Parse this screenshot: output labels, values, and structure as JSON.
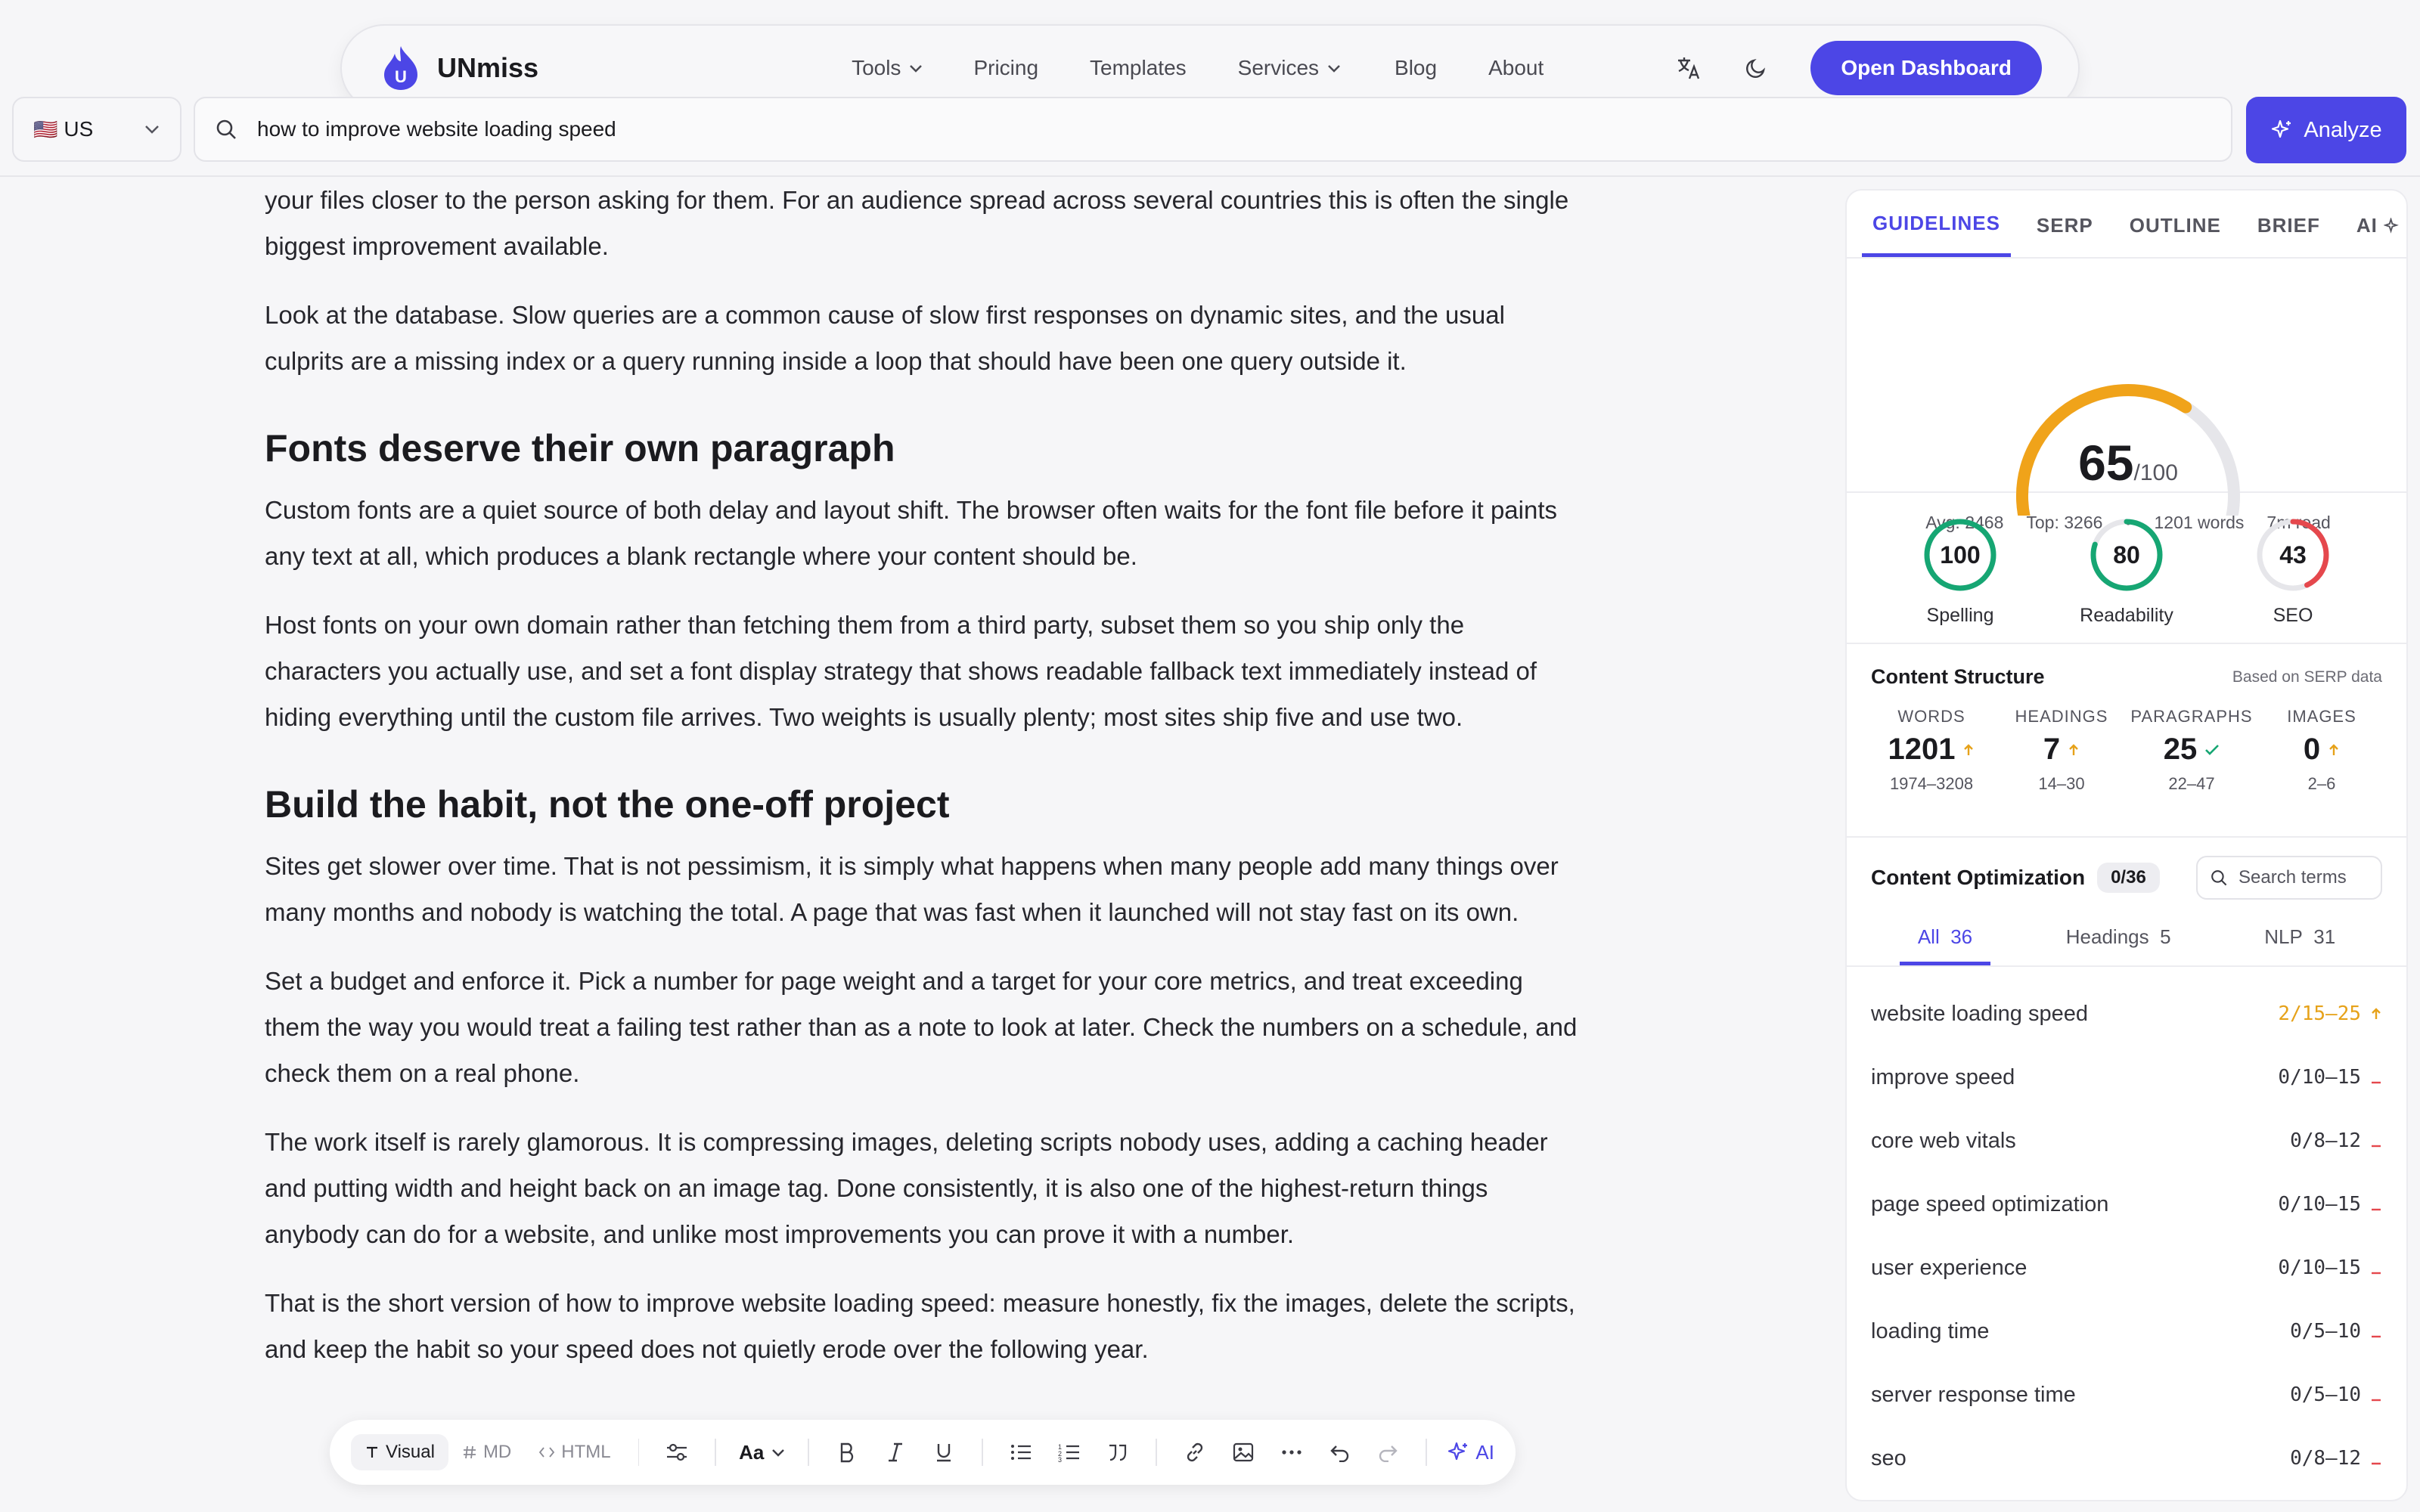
{
  "nav": {
    "brand": "UNmiss",
    "brand_initial": "U",
    "links": [
      "Tools",
      "Pricing",
      "Templates",
      "Services",
      "Blog",
      "About"
    ],
    "open_dashboard": "Open Dashboard",
    "translate_icon": "translate-icon",
    "theme_icon": "moon-icon"
  },
  "search": {
    "country": "US",
    "country_flag": "🇺🇸",
    "query": "how to improve website loading speed",
    "analyze": "Analyze"
  },
  "editor": {
    "p0": "your files closer to the person asking for them. For an audience spread across several countries this is often the single biggest improvement available.",
    "p1": "Look at the database. Slow queries are a common cause of slow first responses on dynamic sites, and the usual culprits are a missing index or a query running inside a loop that should have been one query outside it.",
    "h1": "Fonts deserve their own paragraph",
    "p2": "Custom fonts are a quiet source of both delay and layout shift. The browser often waits for the font file before it paints any text at all, which produces a blank rectangle where your content should be.",
    "p3": "Host fonts on your own domain rather than fetching them from a third party, subset them so you ship only the characters you actually use, and set a font display strategy that shows readable fallback text immediately instead of hiding everything until the custom file arrives. Two weights is usually plenty; most sites ship five and use two.",
    "h2": "Build the habit, not the one-off project",
    "p4": "Sites get slower over time. That is not pessimism, it is simply what happens when many people add many things over many months and nobody is watching the total. A page that was fast when it launched will not stay fast on its own.",
    "p5": "Set a budget and enforce it. Pick a number for page weight and a target for your core metrics, and treat exceeding them the way you would treat a failing test rather than as a note to look at later. Check the numbers on a schedule, and check them on a real phone.",
    "p6": "The work itself is rarely glamorous. It is compressing images, deleting scripts nobody uses, adding a caching header and putting width and height back on an image tag. Done consistently, it is also one of the highest-return things anybody can do for a website, and unlike most improvements you can prove it with a number.",
    "p7": "That is the short version of how to improve website loading speed: measure honestly, fix the images, delete the scripts, and keep the habit so your speed does not quietly erode over the following year."
  },
  "toolbar": {
    "modes": [
      "Visual",
      "MD",
      "HTML"
    ],
    "font_label": "Aa",
    "ai_label": "AI"
  },
  "panel": {
    "tabs": [
      "GUIDELINES",
      "SERP",
      "OUTLINE",
      "BRIEF",
      "AI"
    ],
    "score": {
      "value": "65",
      "denominator": "/100",
      "fraction": 0.65,
      "avg": "Avg: 2468",
      "top": "Top: 3266",
      "bullet": "•",
      "words": "1201 words",
      "read": "7m read"
    },
    "rings": [
      {
        "value": "100",
        "label": "Spelling",
        "fraction": 1.0,
        "color": "#16a673"
      },
      {
        "value": "80",
        "label": "Readability",
        "fraction": 0.8,
        "color": "#16a673"
      },
      {
        "value": "43",
        "label": "SEO",
        "fraction": 0.43,
        "color": "#e5484d"
      }
    ],
    "structure": {
      "title": "Content Structure",
      "note": "Based on SERP data",
      "cols": [
        {
          "label": "WORDS",
          "value": "1201",
          "range": "1974–3208",
          "status": "up"
        },
        {
          "label": "HEADINGS",
          "value": "7",
          "range": "14–30",
          "status": "up"
        },
        {
          "label": "PARAGRAPHS",
          "value": "25",
          "range": "22–47",
          "status": "ok"
        },
        {
          "label": "IMAGES",
          "value": "0",
          "range": "2–6",
          "status": "up"
        }
      ]
    },
    "optimization": {
      "title": "Content Optimization",
      "badge": "0/36",
      "search_placeholder": "Search terms",
      "subtabs": [
        {
          "label": "All",
          "count": "36"
        },
        {
          "label": "Headings",
          "count": "5"
        },
        {
          "label": "NLP",
          "count": "31"
        }
      ],
      "terms": [
        {
          "name": "website loading speed",
          "count": "2/15–25",
          "status": "up"
        },
        {
          "name": "improve speed",
          "count": "0/10–15",
          "status": "missing"
        },
        {
          "name": "core web vitals",
          "count": "0/8–12",
          "status": "missing"
        },
        {
          "name": "page speed optimization",
          "count": "0/10–15",
          "status": "missing"
        },
        {
          "name": "user experience",
          "count": "0/10–15",
          "status": "missing"
        },
        {
          "name": "loading time",
          "count": "0/5–10",
          "status": "missing"
        },
        {
          "name": "server response time",
          "count": "0/5–10",
          "status": "missing"
        },
        {
          "name": "seo",
          "count": "0/8–12",
          "status": "missing"
        }
      ]
    }
  },
  "colors": {
    "accent": "#4c46e6",
    "warning": "#e6a21a",
    "success": "#16a673",
    "danger": "#e5484d"
  }
}
